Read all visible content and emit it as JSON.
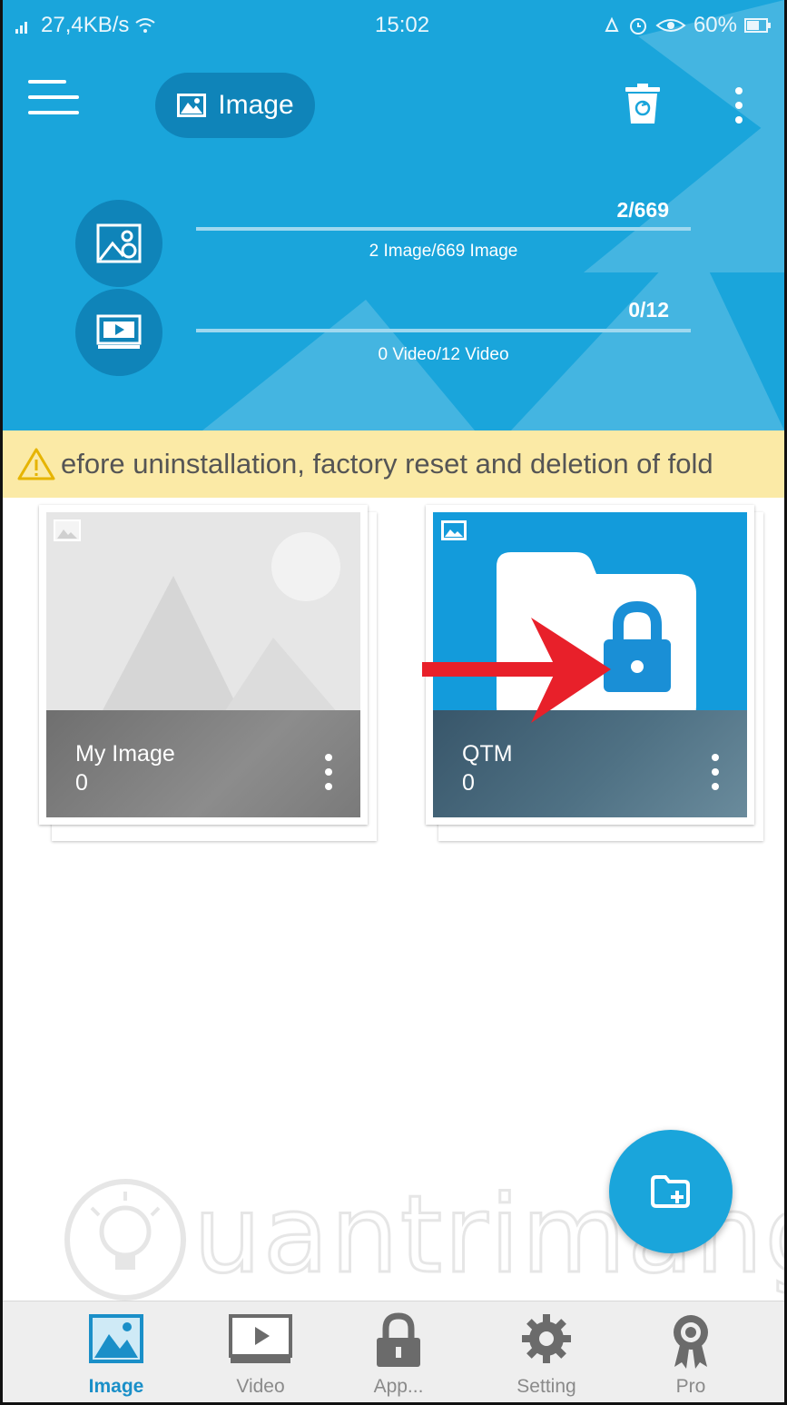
{
  "status_bar": {
    "network": "27,4KB/s",
    "time": "15:02",
    "battery": "60%"
  },
  "header": {
    "mode_label": "Image",
    "stats": [
      {
        "count": "2/669",
        "caption": "2 Image/669 Image",
        "progress": 0.003
      },
      {
        "count": "0/12",
        "caption": "0 Video/12 Video",
        "progress": 0
      }
    ]
  },
  "banner": {
    "text": "efore uninstallation, factory reset and deletion of fold"
  },
  "albums": [
    {
      "name": "My Image",
      "count": "0"
    },
    {
      "name": "QTM",
      "count": "0"
    }
  ],
  "watermark": {
    "text": "uantrimang"
  },
  "bottom_nav": [
    {
      "label": "Image",
      "icon": "image-icon",
      "active": true
    },
    {
      "label": "Video",
      "icon": "video-icon",
      "active": false
    },
    {
      "label": "App...",
      "icon": "lock-icon",
      "active": false
    },
    {
      "label": "Setting",
      "icon": "gear-icon",
      "active": false
    },
    {
      "label": "Pro",
      "icon": "award-icon",
      "active": false
    }
  ],
  "colors": {
    "primary": "#1aa5db",
    "primary_dark": "#0f84b9",
    "banner_bg": "#fbeaa6",
    "arrow": "#e8202a",
    "active_nav": "#1a8fc8"
  }
}
